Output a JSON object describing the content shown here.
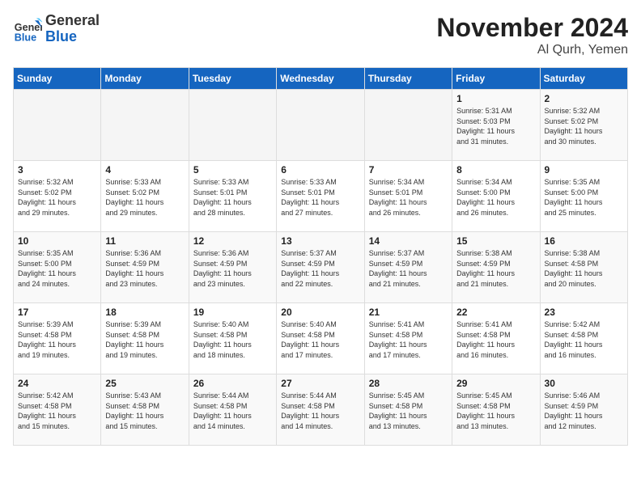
{
  "logo": {
    "general": "General",
    "blue": "Blue"
  },
  "header": {
    "month": "November 2024",
    "location": "Al Qurh, Yemen"
  },
  "weekdays": [
    "Sunday",
    "Monday",
    "Tuesday",
    "Wednesday",
    "Thursday",
    "Friday",
    "Saturday"
  ],
  "weeks": [
    [
      {
        "day": "",
        "info": ""
      },
      {
        "day": "",
        "info": ""
      },
      {
        "day": "",
        "info": ""
      },
      {
        "day": "",
        "info": ""
      },
      {
        "day": "",
        "info": ""
      },
      {
        "day": "1",
        "info": "Sunrise: 5:31 AM\nSunset: 5:03 PM\nDaylight: 11 hours\nand 31 minutes."
      },
      {
        "day": "2",
        "info": "Sunrise: 5:32 AM\nSunset: 5:02 PM\nDaylight: 11 hours\nand 30 minutes."
      }
    ],
    [
      {
        "day": "3",
        "info": "Sunrise: 5:32 AM\nSunset: 5:02 PM\nDaylight: 11 hours\nand 29 minutes."
      },
      {
        "day": "4",
        "info": "Sunrise: 5:33 AM\nSunset: 5:02 PM\nDaylight: 11 hours\nand 29 minutes."
      },
      {
        "day": "5",
        "info": "Sunrise: 5:33 AM\nSunset: 5:01 PM\nDaylight: 11 hours\nand 28 minutes."
      },
      {
        "day": "6",
        "info": "Sunrise: 5:33 AM\nSunset: 5:01 PM\nDaylight: 11 hours\nand 27 minutes."
      },
      {
        "day": "7",
        "info": "Sunrise: 5:34 AM\nSunset: 5:01 PM\nDaylight: 11 hours\nand 26 minutes."
      },
      {
        "day": "8",
        "info": "Sunrise: 5:34 AM\nSunset: 5:00 PM\nDaylight: 11 hours\nand 26 minutes."
      },
      {
        "day": "9",
        "info": "Sunrise: 5:35 AM\nSunset: 5:00 PM\nDaylight: 11 hours\nand 25 minutes."
      }
    ],
    [
      {
        "day": "10",
        "info": "Sunrise: 5:35 AM\nSunset: 5:00 PM\nDaylight: 11 hours\nand 24 minutes."
      },
      {
        "day": "11",
        "info": "Sunrise: 5:36 AM\nSunset: 4:59 PM\nDaylight: 11 hours\nand 23 minutes."
      },
      {
        "day": "12",
        "info": "Sunrise: 5:36 AM\nSunset: 4:59 PM\nDaylight: 11 hours\nand 23 minutes."
      },
      {
        "day": "13",
        "info": "Sunrise: 5:37 AM\nSunset: 4:59 PM\nDaylight: 11 hours\nand 22 minutes."
      },
      {
        "day": "14",
        "info": "Sunrise: 5:37 AM\nSunset: 4:59 PM\nDaylight: 11 hours\nand 21 minutes."
      },
      {
        "day": "15",
        "info": "Sunrise: 5:38 AM\nSunset: 4:59 PM\nDaylight: 11 hours\nand 21 minutes."
      },
      {
        "day": "16",
        "info": "Sunrise: 5:38 AM\nSunset: 4:58 PM\nDaylight: 11 hours\nand 20 minutes."
      }
    ],
    [
      {
        "day": "17",
        "info": "Sunrise: 5:39 AM\nSunset: 4:58 PM\nDaylight: 11 hours\nand 19 minutes."
      },
      {
        "day": "18",
        "info": "Sunrise: 5:39 AM\nSunset: 4:58 PM\nDaylight: 11 hours\nand 19 minutes."
      },
      {
        "day": "19",
        "info": "Sunrise: 5:40 AM\nSunset: 4:58 PM\nDaylight: 11 hours\nand 18 minutes."
      },
      {
        "day": "20",
        "info": "Sunrise: 5:40 AM\nSunset: 4:58 PM\nDaylight: 11 hours\nand 17 minutes."
      },
      {
        "day": "21",
        "info": "Sunrise: 5:41 AM\nSunset: 4:58 PM\nDaylight: 11 hours\nand 17 minutes."
      },
      {
        "day": "22",
        "info": "Sunrise: 5:41 AM\nSunset: 4:58 PM\nDaylight: 11 hours\nand 16 minutes."
      },
      {
        "day": "23",
        "info": "Sunrise: 5:42 AM\nSunset: 4:58 PM\nDaylight: 11 hours\nand 16 minutes."
      }
    ],
    [
      {
        "day": "24",
        "info": "Sunrise: 5:42 AM\nSunset: 4:58 PM\nDaylight: 11 hours\nand 15 minutes."
      },
      {
        "day": "25",
        "info": "Sunrise: 5:43 AM\nSunset: 4:58 PM\nDaylight: 11 hours\nand 15 minutes."
      },
      {
        "day": "26",
        "info": "Sunrise: 5:44 AM\nSunset: 4:58 PM\nDaylight: 11 hours\nand 14 minutes."
      },
      {
        "day": "27",
        "info": "Sunrise: 5:44 AM\nSunset: 4:58 PM\nDaylight: 11 hours\nand 14 minutes."
      },
      {
        "day": "28",
        "info": "Sunrise: 5:45 AM\nSunset: 4:58 PM\nDaylight: 11 hours\nand 13 minutes."
      },
      {
        "day": "29",
        "info": "Sunrise: 5:45 AM\nSunset: 4:58 PM\nDaylight: 11 hours\nand 13 minutes."
      },
      {
        "day": "30",
        "info": "Sunrise: 5:46 AM\nSunset: 4:59 PM\nDaylight: 11 hours\nand 12 minutes."
      }
    ]
  ]
}
